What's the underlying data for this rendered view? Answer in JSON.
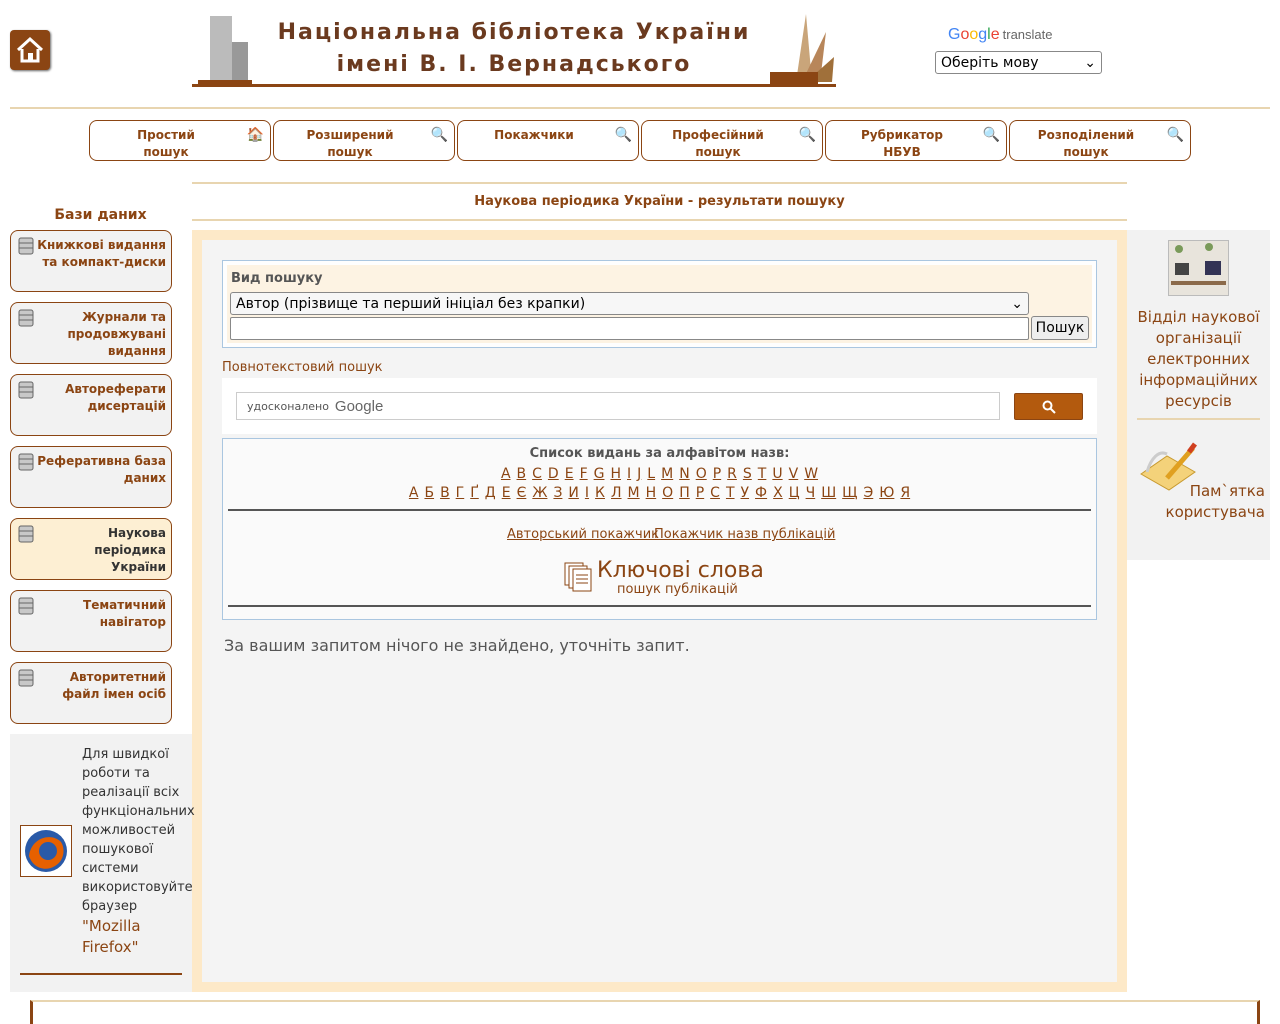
{
  "header": {
    "home_icon": "home-icon",
    "banner_line1": "Національна бібліотека України",
    "banner_line2": "імені В. І. Вернадського",
    "translate_brand": "translate",
    "language_select": "Оберіть мову"
  },
  "search_tabs": [
    {
      "label": "Простий\nпошук",
      "icon": "house-search-icon"
    },
    {
      "label": "Розширений\nпошук",
      "icon": "magnifier-icon"
    },
    {
      "label": "Покажчики",
      "icon": "magnifier-icon"
    },
    {
      "label": "Професійний\nпошук",
      "icon": "magnifier-icon"
    },
    {
      "label": "Рубрикатор\nНБУВ",
      "icon": "magnifier-icon"
    },
    {
      "label": "Розподілений\nпошук",
      "icon": "magnifier-icon"
    }
  ],
  "main": {
    "title": "Наукова періодика України - результати пошуку",
    "search_type_label": "Вид пошуку",
    "search_type_value": "Автор (прізвище та перший ініціал без крапки)",
    "search_button": "Пошук",
    "fulltext_label": "Повнотекстовий пошук",
    "gcse_prefix": "удосконалено",
    "gcse_brand": "Google",
    "alpha_title": "Список видань за алфавітом назв:",
    "alpha_latin": [
      "A",
      "B",
      "C",
      "D",
      "E",
      "F",
      "G",
      "H",
      "I",
      "J",
      "L",
      "M",
      "N",
      "O",
      "P",
      "R",
      "S",
      "T",
      "U",
      "V",
      "W"
    ],
    "alpha_cyrillic": [
      "А",
      "Б",
      "В",
      "Г",
      "Ґ",
      "Д",
      "Е",
      "Є",
      "Ж",
      "З",
      "И",
      "І",
      "К",
      "Л",
      "М",
      "Н",
      "О",
      "П",
      "Р",
      "С",
      "Т",
      "У",
      "Ф",
      "Х",
      "Ц",
      "Ч",
      "Ш",
      "Щ",
      "Э",
      "Ю",
      "Я"
    ],
    "author_index": "Авторський покажчик",
    "title_index": "Покажчик назв публікацій",
    "keywords_title": "Ключові слова",
    "keywords_sub": "пошук публікацій",
    "no_results": "За вашим запитом нічого не знайдено, уточніть запит."
  },
  "sidebar": {
    "heading": "Бази даних",
    "items": [
      {
        "label": "Книжкові видання та компакт-диски",
        "active": false
      },
      {
        "label": "Журнали та продовжувані видання",
        "active": false
      },
      {
        "label": "Автореферати дисертацій",
        "active": false
      },
      {
        "label": "Реферативна база даних",
        "active": false
      },
      {
        "label": "Наукова періодика України",
        "active": true
      },
      {
        "label": "Тематичний навігатор",
        "active": false
      },
      {
        "label": "Авторитетний файл імен осіб",
        "active": false
      }
    ],
    "firefox_text": "Для швидкої роботи та реалізації всіх функціональних можливостей пошукової системи використовуйте браузер",
    "firefox_link": "\"Mozilla Firefox\""
  },
  "right": {
    "dept_text": "Відділ наукової організації електронних інформаційних ресурсів",
    "memo_text": "Пам`ятка користувача"
  },
  "colors": {
    "accent": "#8b4513",
    "frame": "#fde9c8",
    "search_button": "#b35a0e"
  }
}
